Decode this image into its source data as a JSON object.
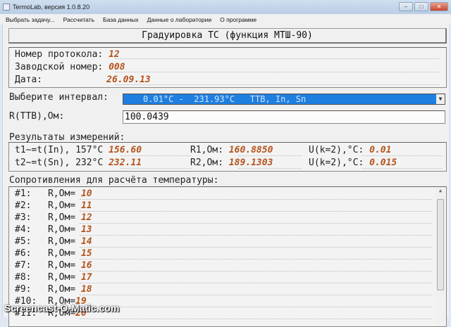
{
  "window": {
    "title": "TermoLab, версия 1.0.8.20"
  },
  "menu": [
    "Выбрать задачу...",
    "Рассчитать",
    "База данных",
    "Данные о лаборатории",
    "О программе"
  ],
  "heading": "Градуировка ТС (функция МТШ-90)",
  "protocol": {
    "number_label": "Номер протокола:",
    "number": "12",
    "serial_label": "Заводской номер:",
    "serial": "008",
    "date_label": "Дата:",
    "date": "26.09.13"
  },
  "interval": {
    "label": "Выберите интервал:",
    "selected": "0.01°C -  231.93°C   ТТВ, In, Sn"
  },
  "rttb": {
    "label": "R(ТТВ),Ом:",
    "value": "100.0439"
  },
  "results": {
    "label": "Результаты измерений:",
    "rows": [
      {
        "t_label": "t1~=t(In), 157°C",
        "t": "156.60",
        "r_label": "R1,Ом:",
        "r": "160.8850",
        "u_label": "U(k=2),°C:",
        "u": "0.01"
      },
      {
        "t_label": "t2~=t(Sn), 232°C",
        "t": "232.11",
        "r_label": "R2,Ом:",
        "r": "189.1303",
        "u_label": "U(k=2),°C:",
        "u": "0.015"
      }
    ]
  },
  "resistances": {
    "label": "Сопротивления для расчёта температуры:",
    "rows": [
      {
        "n": "#1:",
        "label": "R,Ом=",
        "v": "10"
      },
      {
        "n": "#2:",
        "label": "R,Ом=",
        "v": "11"
      },
      {
        "n": "#3:",
        "label": "R,Ом=",
        "v": "12"
      },
      {
        "n": "#4:",
        "label": "R,Ом=",
        "v": "13"
      },
      {
        "n": "#5:",
        "label": "R,Ом=",
        "v": "14"
      },
      {
        "n": "#6:",
        "label": "R,Ом=",
        "v": "15"
      },
      {
        "n": "#7:",
        "label": "R,Ом=",
        "v": "16"
      },
      {
        "n": "#8:",
        "label": "R,Ом=",
        "v": "17"
      },
      {
        "n": "#9:",
        "label": "R,Ом=",
        "v": "18"
      },
      {
        "n": "#10:",
        "label": "R,Ом=",
        "v": "19"
      },
      {
        "n": "#11:",
        "label": "R,Ом=",
        "v": "20"
      }
    ]
  },
  "watermark": "Screencast-O-Matic.com"
}
